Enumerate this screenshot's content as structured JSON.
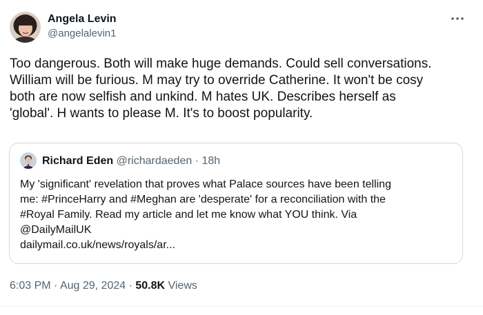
{
  "author": {
    "name": "Angela Levin",
    "handle": "@angelalevin1"
  },
  "tweet": {
    "lines": [
      "Too dangerous.  Both will make huge demands. Could sell conversations.",
      "William will be furious.  M may try to override Catherine. It won't be cosy",
      "both are now  selfish and unkind. M hates UK. Describes  herself as",
      "'global'.  H wants to please M. It's to boost popularity."
    ]
  },
  "quote": {
    "name": "Richard Eden",
    "handle": "@richardaeden",
    "separator": " · ",
    "time": "18h",
    "lines": [
      "My 'significant' revelation that proves what Palace sources have been telling",
      "me: #PrinceHarry and #Meghan are 'desperate' for a reconciliation with the",
      "#Royal Family. Read my article and let me know what YOU think. Via",
      "@DailyMailUK",
      "dailymail.co.uk/news/royals/ar..."
    ]
  },
  "meta": {
    "time": "6:03 PM",
    "sep1": " · ",
    "date": "Aug 29, 2024",
    "sep2": " · ",
    "views_count": "50.8K",
    "views_label": " Views"
  },
  "icons": {
    "more": "more-horizontal-icon"
  },
  "colors": {
    "text": "#0f1419",
    "secondary": "#536471",
    "border": "#cfd9de"
  }
}
